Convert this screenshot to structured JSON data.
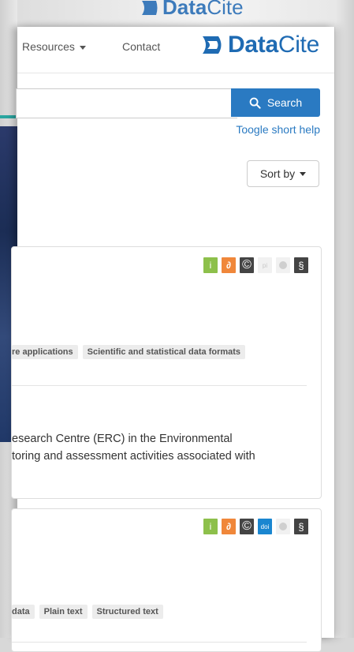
{
  "background": {
    "top_logo_prefix": "Data",
    "top_logo_suffix": "Cite"
  },
  "navbar": {
    "resources_label": "Resources",
    "contact_label": "Contact",
    "brand_prefix": "Data",
    "brand_suffix": "Cite"
  },
  "search": {
    "input_value": "",
    "button_label": "Search",
    "help_link": "Toogle short help"
  },
  "sort": {
    "label": "Sort by"
  },
  "results": [
    {
      "badges": [
        "i",
        "∂",
        "©",
        "pi",
        "",
        "§"
      ],
      "tags": [
        "re applications",
        "Scientific and statistical data formats"
      ],
      "description_line1": "esearch Centre (ERC) in the Environmental",
      "description_line2": "toring and assessment activities associated with"
    },
    {
      "badges": [
        "i",
        "∂",
        "©",
        "doi",
        "",
        "§"
      ],
      "tags": [
        "data",
        "Plain text",
        "Structured text"
      ]
    }
  ],
  "colors": {
    "brand": "#1f6bb3",
    "search_button": "#2a7ac2",
    "badge_info": "#8dc04b",
    "badge_open_access": "#f0873a",
    "badge_dark": "#444444",
    "badge_doi": "#1a86d0"
  }
}
